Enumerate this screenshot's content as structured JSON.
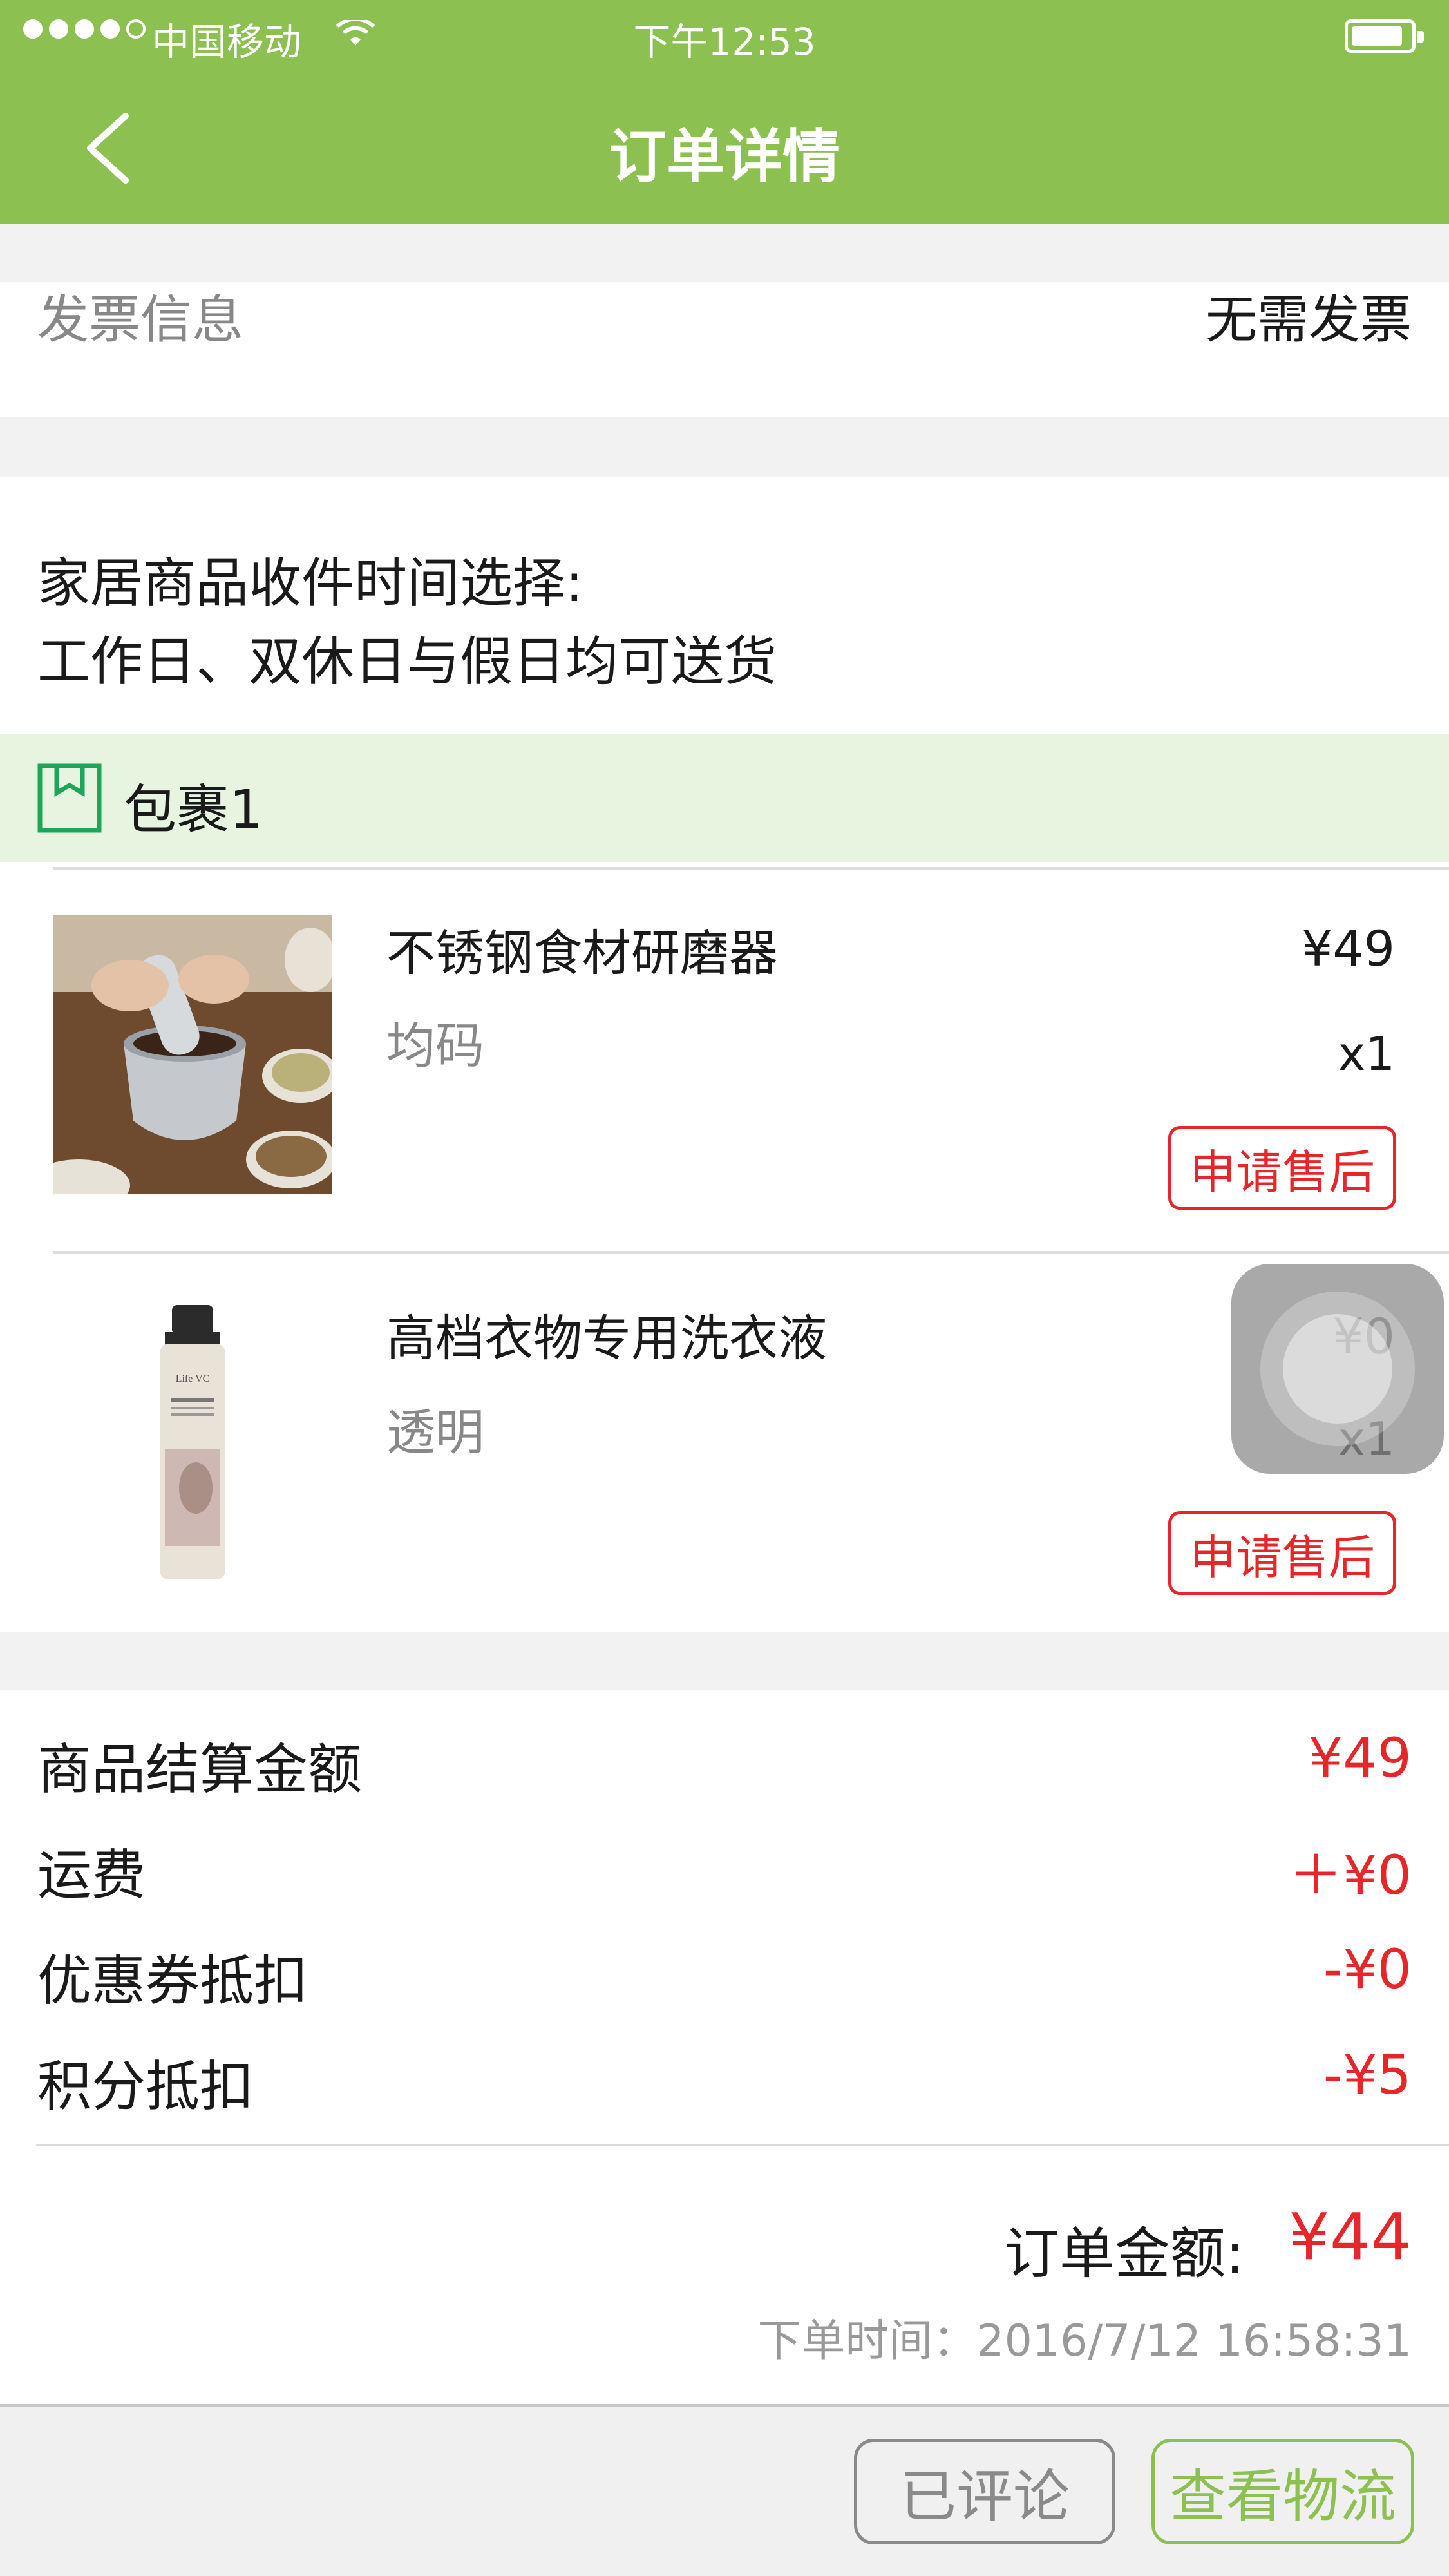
{
  "status_bar": {
    "carrier": "中国移动",
    "time": "下午12:53"
  },
  "nav": {
    "title": "订单详情",
    "back_icon": "chevron-left-icon"
  },
  "invoice": {
    "label": "发票信息",
    "value": "无需发票"
  },
  "delivery": {
    "line1": "家居商品收件时间选择:",
    "line2": "工作日、双休日与假日均可送货"
  },
  "package": {
    "icon": "package-icon",
    "label": "包裹1"
  },
  "items": [
    {
      "name": "不锈钢食材研磨器",
      "spec": "均码",
      "price": "¥49",
      "qty": "x1",
      "action": "申请售后"
    },
    {
      "name": "高档衣物专用洗衣液",
      "spec": "透明",
      "price": "¥0",
      "qty": "x1",
      "action": "申请售后",
      "product_text": "Life VC"
    }
  ],
  "summary": {
    "rows": [
      {
        "label": "商品结算金额",
        "value": "¥49"
      },
      {
        "label": "运费",
        "value": "＋¥0"
      },
      {
        "label": "优惠券抵扣",
        "value": "-¥0"
      },
      {
        "label": "积分抵扣",
        "value": "-¥5"
      }
    ],
    "total_label": "订单金额:",
    "total_value": "¥44",
    "order_time": "下单时间：2016/7/12 16:58:31"
  },
  "bottom": {
    "reviewed": "已评论",
    "logistics": "查看物流"
  },
  "colors": {
    "brand": "#8cc152",
    "price_red": "#e8262a"
  }
}
